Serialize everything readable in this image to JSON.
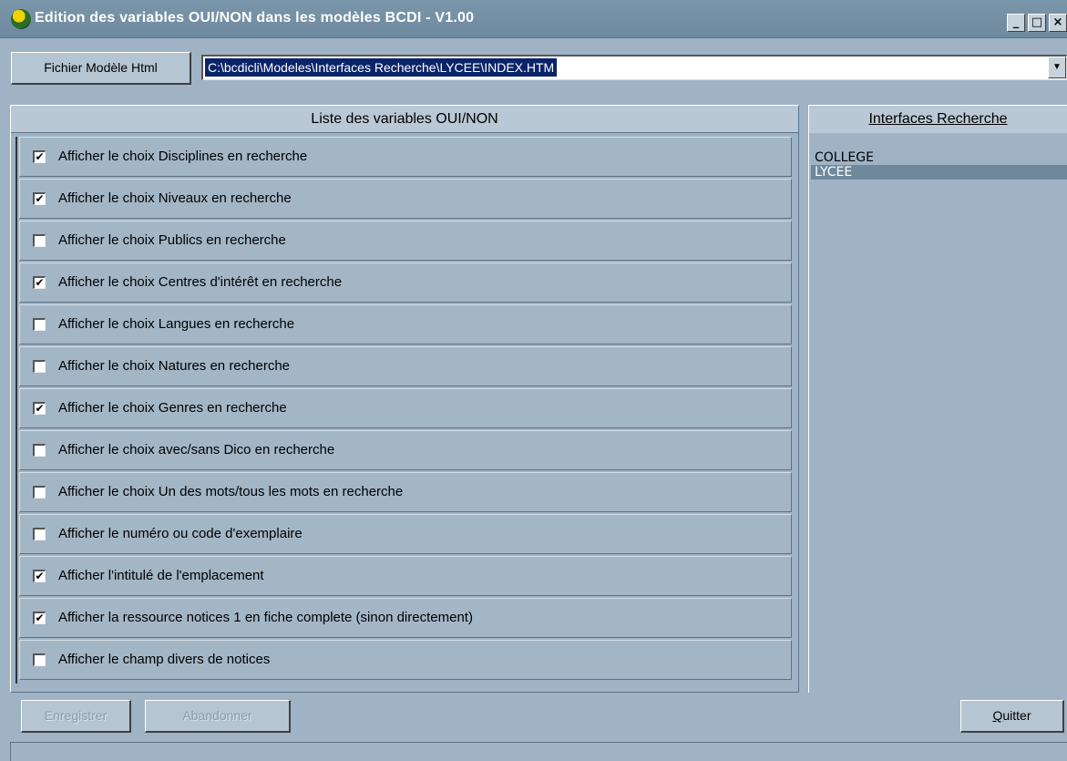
{
  "window": {
    "title": "Edition des variables OUI/NON dans les modèles BCDI - V1.00",
    "icon": "app-globe-icon",
    "controls": [
      "_",
      "□",
      "×"
    ]
  },
  "toolbar": {
    "file_button": "Fichier Modèle Html",
    "path_value": "C:\\bcdicli\\Modeles\\Interfaces Recherche\\LYCEE\\INDEX.HTM",
    "dropdown_arrow": "▼"
  },
  "list": {
    "header": "Liste des variables OUI/NON",
    "items": [
      {
        "label": "Afficher le choix Disciplines en recherche",
        "checked": true
      },
      {
        "label": "Afficher le choix Niveaux en recherche",
        "checked": true
      },
      {
        "label": "Afficher le choix Publics en recherche",
        "checked": false
      },
      {
        "label": "Afficher le choix Centres d'intérêt en recherche",
        "checked": true
      },
      {
        "label": "Afficher le choix Langues en recherche",
        "checked": false
      },
      {
        "label": "Afficher le choix Natures en recherche",
        "checked": false
      },
      {
        "label": "Afficher le choix Genres en recherche",
        "checked": true
      },
      {
        "label": "Afficher le choix avec/sans Dico en recherche",
        "checked": false
      },
      {
        "label": "Afficher le choix Un des mots/tous les mots en recherche",
        "checked": false
      },
      {
        "label": "Afficher le numéro ou code d'exemplaire",
        "checked": false
      },
      {
        "label": "Afficher l'intitulé de l'emplacement",
        "checked": true
      },
      {
        "label": "Afficher la ressource notices 1  en fiche complete (sinon directement)",
        "checked": true
      },
      {
        "label": "Afficher le champ divers de notices",
        "checked": false
      }
    ]
  },
  "interfaces": {
    "header": "Interfaces Recherche",
    "items": [
      "COLLEGE",
      "LYCEE"
    ],
    "selected": "LYCEE"
  },
  "buttons": {
    "save": "Enregistrer",
    "abandon": "Abandonner",
    "quit_first": "Q",
    "quit_rest": "uitter"
  }
}
